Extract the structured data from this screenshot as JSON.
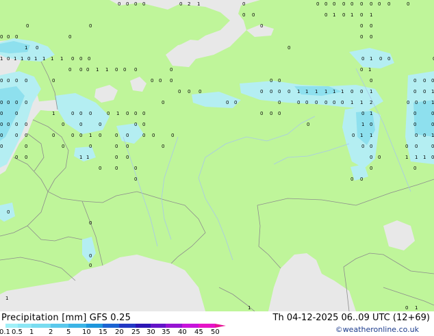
{
  "header": {
    "title_left": "Precipitation [mm]  GFS 0.25",
    "title_right": "Th 04-12-2025 06..09 UTC (12+69)",
    "credit": "©weatheronline.co.uk"
  },
  "legend": {
    "ticks": [
      "0.1",
      "0.5",
      "1",
      "2",
      "5",
      "10",
      "15",
      "20",
      "25",
      "30",
      "35",
      "40",
      "45",
      "50"
    ],
    "colors": [
      "#a0f0f8",
      "#8ce6f4",
      "#78dcf0",
      "#5ac8ec",
      "#3cb4e6",
      "#1e96dc",
      "#1c64d2",
      "#2238c4",
      "#2c16b4",
      "#6414c8",
      "#9614d2",
      "#c814dc",
      "#e614c8",
      "#e61496"
    ]
  },
  "map": {
    "colors": {
      "land": "#bff59a",
      "sea": "#e8e8e8",
      "border": "#8c8c8c",
      "precip_light": "#b4eef2",
      "precip_moderate": "#8ee0ee"
    },
    "markers": [
      "0",
      "1",
      "2"
    ]
  }
}
